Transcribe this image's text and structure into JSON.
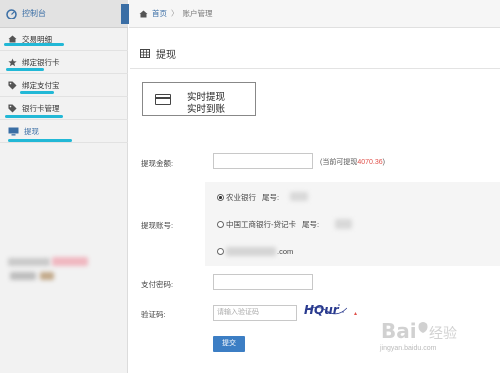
{
  "sidebar": {
    "header": "控制台",
    "items": [
      {
        "label": "交易明细",
        "icon": "home-icon"
      },
      {
        "label": "绑定银行卡",
        "icon": "star-icon"
      },
      {
        "label": "绑定支付宝",
        "icon": "tag-icon"
      },
      {
        "label": "银行卡管理",
        "icon": "tag-icon"
      },
      {
        "label": "提现",
        "icon": "monitor-icon"
      }
    ]
  },
  "breadcrumb": {
    "home": "首页",
    "sep": "〉",
    "current": "账户管理"
  },
  "panel": {
    "title": "提现"
  },
  "method": {
    "line1": "实时提现",
    "line2": "实时到账"
  },
  "form": {
    "amount_label": "提现金额:",
    "amount_hint_prefix": "(当前可提现",
    "amount_value": "4070.36",
    "amount_hint_suffix": ")",
    "account_label": "提现账号:",
    "accounts": [
      {
        "bank": "农业银行",
        "tail_label": "尾号:",
        "selected": true
      },
      {
        "bank": "中国工商银行-贷记卡",
        "tail_label": "尾号:",
        "selected": false
      },
      {
        "bank": ".com",
        "tail_label": "",
        "selected": false
      }
    ],
    "password_label": "支付密码:",
    "captcha_label": "验证码:",
    "captcha_placeholder": "请输入验证码",
    "captcha_text": "HQur",
    "submit": "提交"
  },
  "watermark": {
    "site": "jingyan.baidu.com"
  },
  "colors": {
    "accent": "#3a6ea5",
    "highlight": "#22b8d6",
    "amount": "#e0504a",
    "button": "#3c7ec4"
  }
}
